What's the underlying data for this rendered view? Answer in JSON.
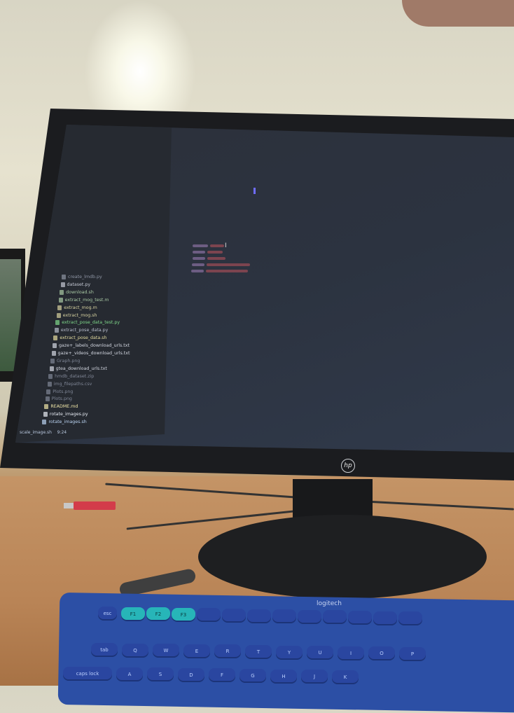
{
  "editor": {
    "files": [
      {
        "name": "create_lmdb.py",
        "color": "#8d94a3"
      },
      {
        "name": "dataset.py",
        "color": "#c7cbd6"
      },
      {
        "name": "download.sh",
        "color": "#a9c9a4"
      },
      {
        "name": "extract_mog_test.m",
        "color": "#a9c9a4"
      },
      {
        "name": "extract_mog.m",
        "color": "#d7d2a0"
      },
      {
        "name": "extract_mog.sh",
        "color": "#d7d2a0"
      },
      {
        "name": "extract_pose_data_test.py",
        "color": "#7fd88a"
      },
      {
        "name": "extract_pose_data.py",
        "color": "#b6bccb"
      },
      {
        "name": "extract_pose_data.sh",
        "color": "#e4dca0"
      },
      {
        "name": "gaze+_labels_download_urls.txt",
        "color": "#d4d8e2"
      },
      {
        "name": "gaze+_videos_download_urls.txt",
        "color": "#d4d8e2"
      },
      {
        "name": "Graph.png",
        "color": "#7f8696"
      },
      {
        "name": "gtea_download_urls.txt",
        "color": "#d4d8e2"
      },
      {
        "name": "hmdb_dataset.zip",
        "color": "#7f8696"
      },
      {
        "name": "img_filepaths.csv",
        "color": "#7f8696"
      },
      {
        "name": "Plots.png",
        "color": "#7f8696"
      },
      {
        "name": "Plots.png",
        "color": "#7f8696"
      },
      {
        "name": "README.md",
        "color": "#f0e6a8"
      },
      {
        "name": "rotate_images.py",
        "color": "#e8ecf4"
      },
      {
        "name": "rotate_images.sh",
        "color": "#b9d2f0"
      }
    ],
    "status": {
      "file": "scale_image.sh",
      "position": "9:24"
    }
  },
  "monitor": {
    "brand": "hp"
  },
  "keyboard": {
    "brand": "logitech",
    "keys": [
      "esc",
      "F1",
      "F2",
      "F3",
      "",
      "",
      "",
      "",
      "",
      "",
      "",
      "",
      "",
      "tab",
      "Q",
      "W",
      "E",
      "R",
      "T",
      "Y",
      "U",
      "I",
      "O",
      "P",
      "caps lock",
      "A",
      "S",
      "D",
      "F",
      "G",
      "H",
      "J",
      "K"
    ]
  }
}
